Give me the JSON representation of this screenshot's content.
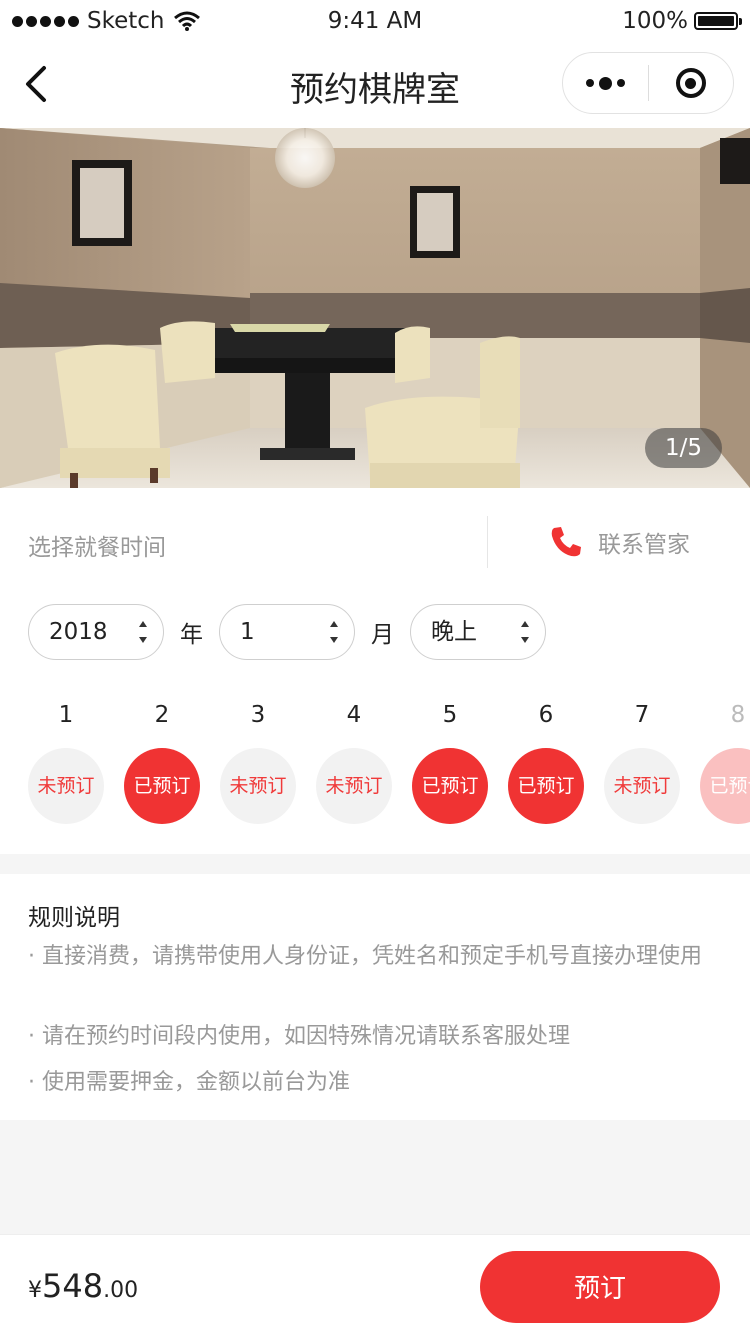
{
  "status_bar": {
    "carrier": "Sketch",
    "time": "9:41 AM",
    "battery": "100%"
  },
  "nav": {
    "title": "预约棋牌室",
    "back_icon": "chevron-left-icon",
    "more_icon": "more-dots-icon",
    "close_icon": "target-circle-icon"
  },
  "hero": {
    "pager": "1/5",
    "image_subject": "mahjong-room-photo"
  },
  "booking": {
    "choose_label": "选择就餐时间",
    "contact_label": "联系管家",
    "contact_icon": "phone-icon",
    "year": {
      "value": "2018",
      "unit": "年"
    },
    "month": {
      "value": "1",
      "unit": "月"
    },
    "period": {
      "value": "晚上"
    },
    "days": [
      {
        "num": "1",
        "status": "未预订",
        "booked": false
      },
      {
        "num": "2",
        "status": "已预订",
        "booked": true
      },
      {
        "num": "3",
        "status": "未预订",
        "booked": false
      },
      {
        "num": "4",
        "status": "未预订",
        "booked": false
      },
      {
        "num": "5",
        "status": "已预订",
        "booked": true
      },
      {
        "num": "6",
        "status": "已预订",
        "booked": true
      },
      {
        "num": "7",
        "status": "未预订",
        "booked": false
      },
      {
        "num": "8",
        "status": "已预订",
        "booked": true
      }
    ]
  },
  "rules": {
    "title": "规则说明",
    "items": [
      "· 直接消费，请携带使用人身份证，凭姓名和预定手机号直接办理使用",
      "· 请在预约时间段内使用，如因特殊情况请联系客服处理",
      "· 使用需要押金，金额以前台为准"
    ]
  },
  "footer": {
    "currency": "¥",
    "price_int": "548",
    "price_dec": ".00",
    "book_label": "预订"
  },
  "colors": {
    "accent": "#f03333",
    "muted": "#999999",
    "bg": "#f5f5f5"
  }
}
